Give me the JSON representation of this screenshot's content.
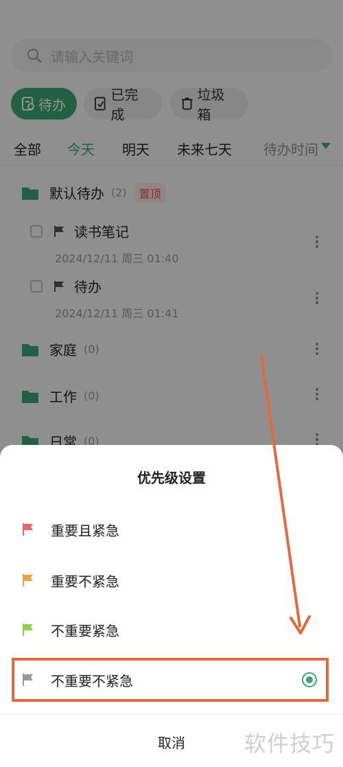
{
  "search": {
    "placeholder": "请输入关键词",
    "icon": "search-icon"
  },
  "segments": [
    {
      "label": "待办",
      "icon": "todo-icon",
      "active": true
    },
    {
      "label": "已完成",
      "icon": "done-icon",
      "active": false
    },
    {
      "label": "垃圾箱",
      "icon": "trash-icon",
      "active": false
    }
  ],
  "filters": [
    {
      "label": "全部",
      "selected": false
    },
    {
      "label": "今天",
      "selected": true
    },
    {
      "label": "明天",
      "selected": false
    },
    {
      "label": "未来七天",
      "selected": false
    }
  ],
  "sort": {
    "label": "待办时间"
  },
  "groups": [
    {
      "name": "默认待办",
      "count": "(2)",
      "pin": "置顶",
      "tasks": [
        {
          "title": "读书笔记",
          "date": "2024/12/11 周三 01:40"
        },
        {
          "title": "待办",
          "date": "2024/12/11 周三 01:41"
        }
      ]
    },
    {
      "name": "家庭",
      "count": "(0)"
    },
    {
      "name": "工作",
      "count": "(0)"
    },
    {
      "name": "日常",
      "count": "(0)"
    }
  ],
  "sheet": {
    "title": "优先级设置",
    "options": [
      {
        "label": "重要且紧急",
        "flag_color": "#e9646b",
        "selected": false
      },
      {
        "label": "重要不紧急",
        "flag_color": "#f2a23c",
        "selected": false
      },
      {
        "label": "不重要紧急",
        "flag_color": "#8fd14f",
        "selected": false
      },
      {
        "label": "不重要不紧急",
        "flag_color": "#9a9a9a",
        "selected": true
      }
    ],
    "cancel": "取消"
  },
  "watermark": "软件技巧",
  "colors": {
    "accent": "#3aa572",
    "highlight": "#e06a3a"
  }
}
